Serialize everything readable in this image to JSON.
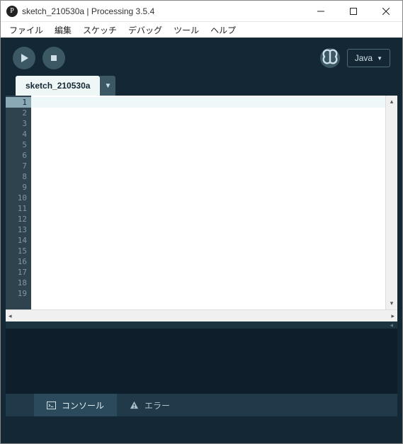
{
  "window": {
    "title": "sketch_210530a | Processing 3.5.4"
  },
  "menu": {
    "file": "ファイル",
    "edit": "編集",
    "sketch": "スケッチ",
    "debug": "デバッグ",
    "tools": "ツール",
    "help": "ヘルプ"
  },
  "toolbar": {
    "mode_label": "Java",
    "mode_arrow": "▼"
  },
  "tabs": {
    "active": "sketch_210530a",
    "dropdown_arrow": "▼"
  },
  "editor": {
    "line_numbers": [
      "1",
      "2",
      "3",
      "4",
      "5",
      "6",
      "7",
      "8",
      "9",
      "10",
      "11",
      "12",
      "13",
      "14",
      "15",
      "16",
      "17",
      "18",
      "19"
    ],
    "active_line": 1,
    "content": ""
  },
  "bottom_tabs": {
    "console": "コンソール",
    "errors": "エラー"
  },
  "scroll": {
    "up": "▴",
    "down": "▾",
    "left": "◂",
    "right": "▸",
    "collapse": "◂"
  }
}
